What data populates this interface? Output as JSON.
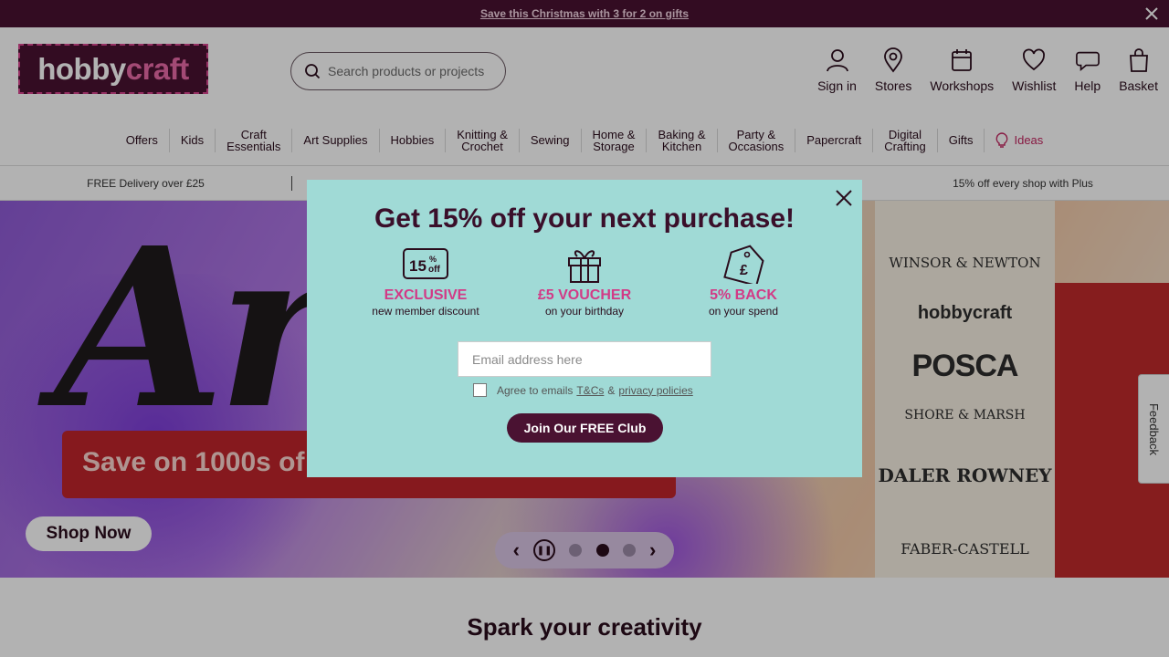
{
  "promo": {
    "text": "Save this Christmas with 3 for 2 on gifts"
  },
  "header": {
    "logo_part1": "hobby",
    "logo_part2": "craft",
    "search_placeholder": "Search products or projects",
    "actions": [
      "Sign in",
      "Stores",
      "Workshops",
      "Wishlist",
      "Help",
      "Basket"
    ]
  },
  "nav": {
    "items": [
      "Offers",
      "Kids",
      "Craft\nEssentials",
      "Art Supplies",
      "Hobbies",
      "Knitting &\nCrochet",
      "Sewing",
      "Home &\nStorage",
      "Baking &\nKitchen",
      "Party &\nOccasions",
      "Papercraft",
      "Digital\nCrafting",
      "Gifts",
      "Ideas"
    ]
  },
  "usp": {
    "items": [
      "FREE Delivery over £25",
      "",
      "",
      "15% off every shop with Plus"
    ]
  },
  "hero": {
    "title": "Art",
    "banner": "Save on 1000s of",
    "cta": "Shop Now",
    "brands": {
      "b1": "WINSOR & NEWTON",
      "b2": "hobbycraft",
      "b3": "POSCA",
      "b4": "SHORE & MARSH",
      "b5": "DALER ROWNEY",
      "b6": "FABER-CASTELL"
    }
  },
  "feedback": "Feedback",
  "section": {
    "title": "Spark your creativity"
  },
  "modal": {
    "title": "Get 15% off your next purchase!",
    "benefits": [
      {
        "icon": "15-off-badge-icon",
        "title": "EXCLUSIVE",
        "subtitle": "new member discount"
      },
      {
        "icon": "gift-icon",
        "title": "£5 VOUCHER",
        "subtitle": "on your birthday"
      },
      {
        "icon": "price-tag-icon",
        "title": "5% BACK",
        "subtitle": "on your spend"
      }
    ],
    "email_placeholder": "Email address here",
    "agree_prefix": "Agree to emails",
    "agree_tcs": "T&Cs",
    "agree_amp": "&",
    "agree_privacy": "privacy policies",
    "join_label": "Join Our FREE Club"
  },
  "colors": {
    "plum": "#4a1232",
    "pink": "#d23a86",
    "modal_bg": "#a0dad6"
  }
}
